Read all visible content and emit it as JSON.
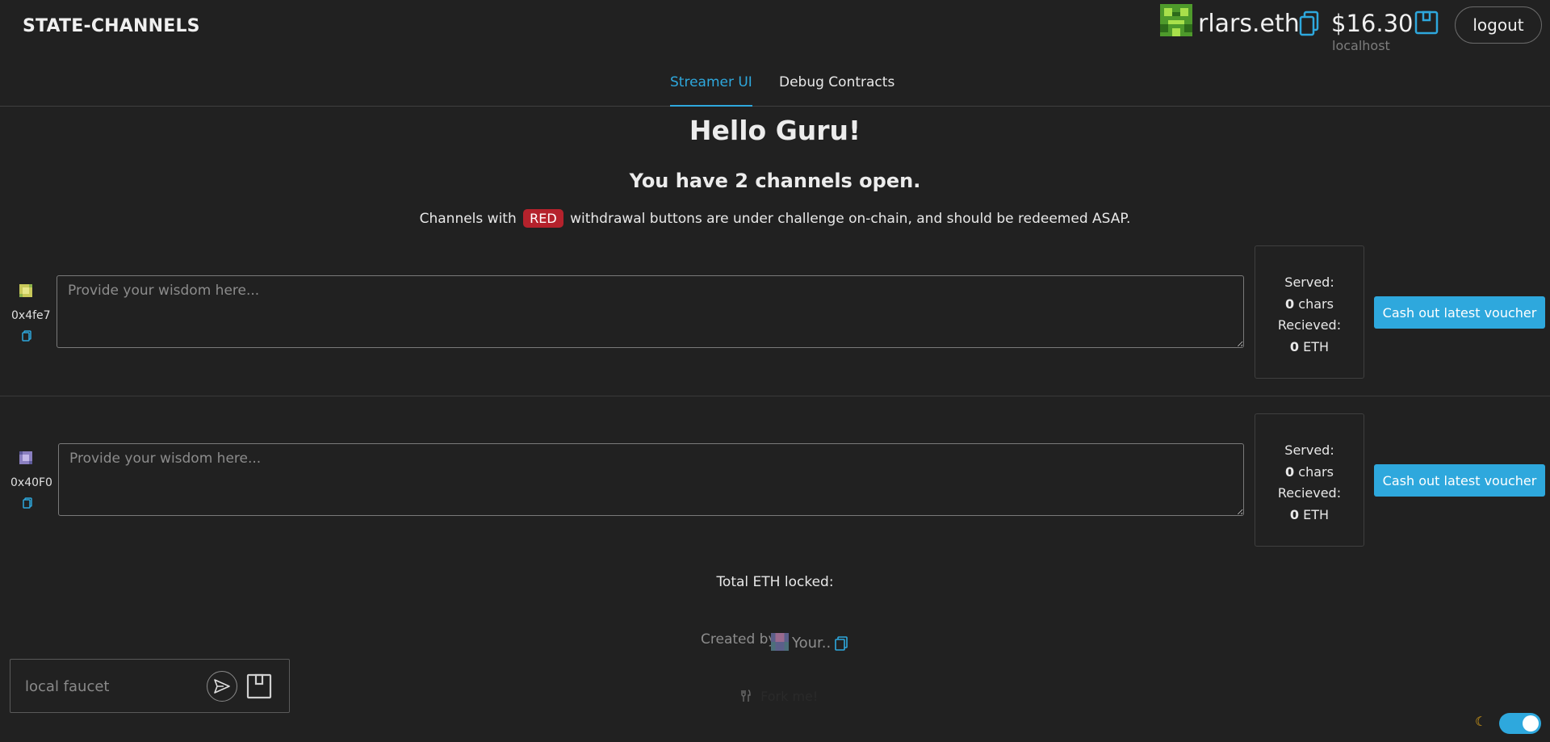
{
  "app": {
    "title": "STATE-CHANNELS"
  },
  "account": {
    "name": "rlars.eth",
    "balance": "$16.30",
    "network": "localhost",
    "logout_label": "logout"
  },
  "tabs": [
    {
      "label": "Streamer UI",
      "active": true
    },
    {
      "label": "Debug Contracts",
      "active": false
    }
  ],
  "main": {
    "greeting": "Hello Guru!",
    "channels_summary": "You have 2 channels open.",
    "note_before": "Channels with",
    "note_badge": "RED",
    "note_after": "withdrawal buttons are under challenge on-chain, and should be redeemed ASAP.",
    "total_locked": "Total ETH locked:"
  },
  "channels": [
    {
      "address": "0x4fe7",
      "placeholder": "Provide your wisdom here...",
      "served_label": "Served:",
      "served_value": "0",
      "served_unit": "chars",
      "received_label": "Recieved:",
      "received_value": "0",
      "received_unit": "ETH",
      "cashout_label": "Cash out latest voucher"
    },
    {
      "address": "0x40F0",
      "placeholder": "Provide your wisdom here...",
      "served_label": "Served:",
      "served_value": "0",
      "served_unit": "chars",
      "received_label": "Recieved:",
      "received_value": "0",
      "received_unit": "ETH",
      "cashout_label": "Cash out latest voucher"
    }
  ],
  "footer": {
    "created_by": "Created by",
    "creator_name": "Your..",
    "fork_label": "Fork me!"
  },
  "faucet": {
    "placeholder": "local faucet"
  },
  "colors": {
    "background": "#212121",
    "accent": "#2ea8dd",
    "danger": "#b5222c"
  },
  "icons": [
    "copy-icon",
    "wallet-icon",
    "send-icon",
    "moon-icon",
    "fork-icon"
  ]
}
